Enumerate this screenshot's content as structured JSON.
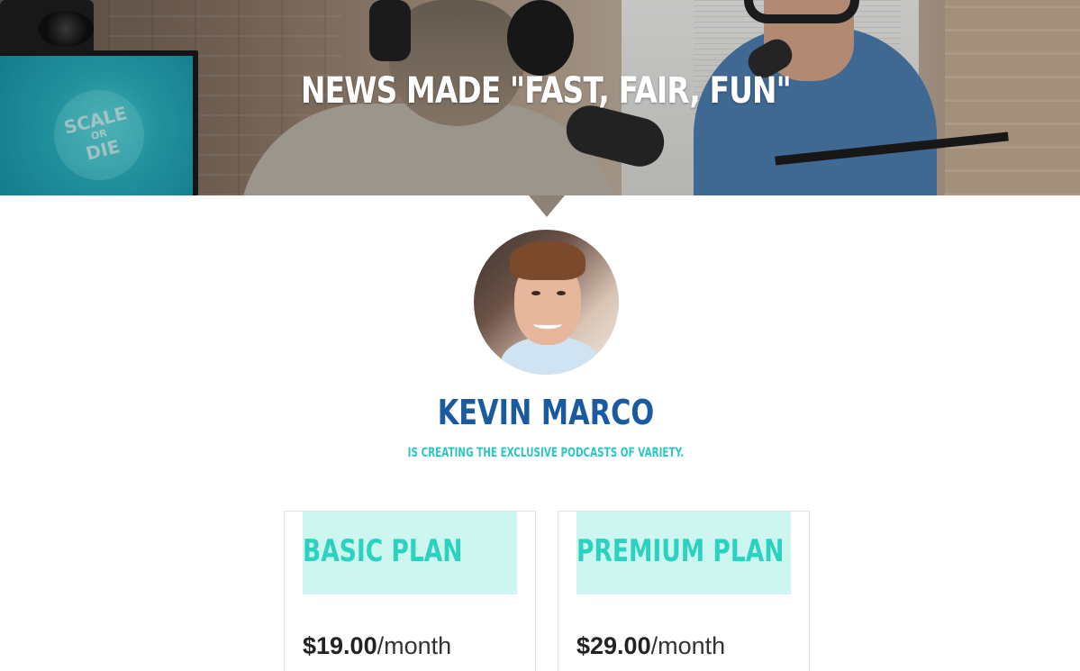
{
  "hero": {
    "title": "NEWS MADE \"FAST, FAIR, FUN\"",
    "monitor_logo_top": "SCALE",
    "monitor_logo_mid": "OR",
    "monitor_logo_bottom": "DIE"
  },
  "creator": {
    "name": "KEVIN MARCO",
    "tagline": "IS CREATING THE EXCLUSIVE PODCASTS OF VARIETY."
  },
  "plans": [
    {
      "name": "BASIC PLAN",
      "price": "$19.00",
      "period": "/month"
    },
    {
      "name": "PREMIUM PLAN",
      "price": "$29.00",
      "period": "/month"
    }
  ],
  "colors": {
    "name": "#1a5aa0",
    "tagline": "#2ec7c0",
    "plan_header_bg": "#cdf6f0",
    "plan_name": "#2ad2bf"
  }
}
